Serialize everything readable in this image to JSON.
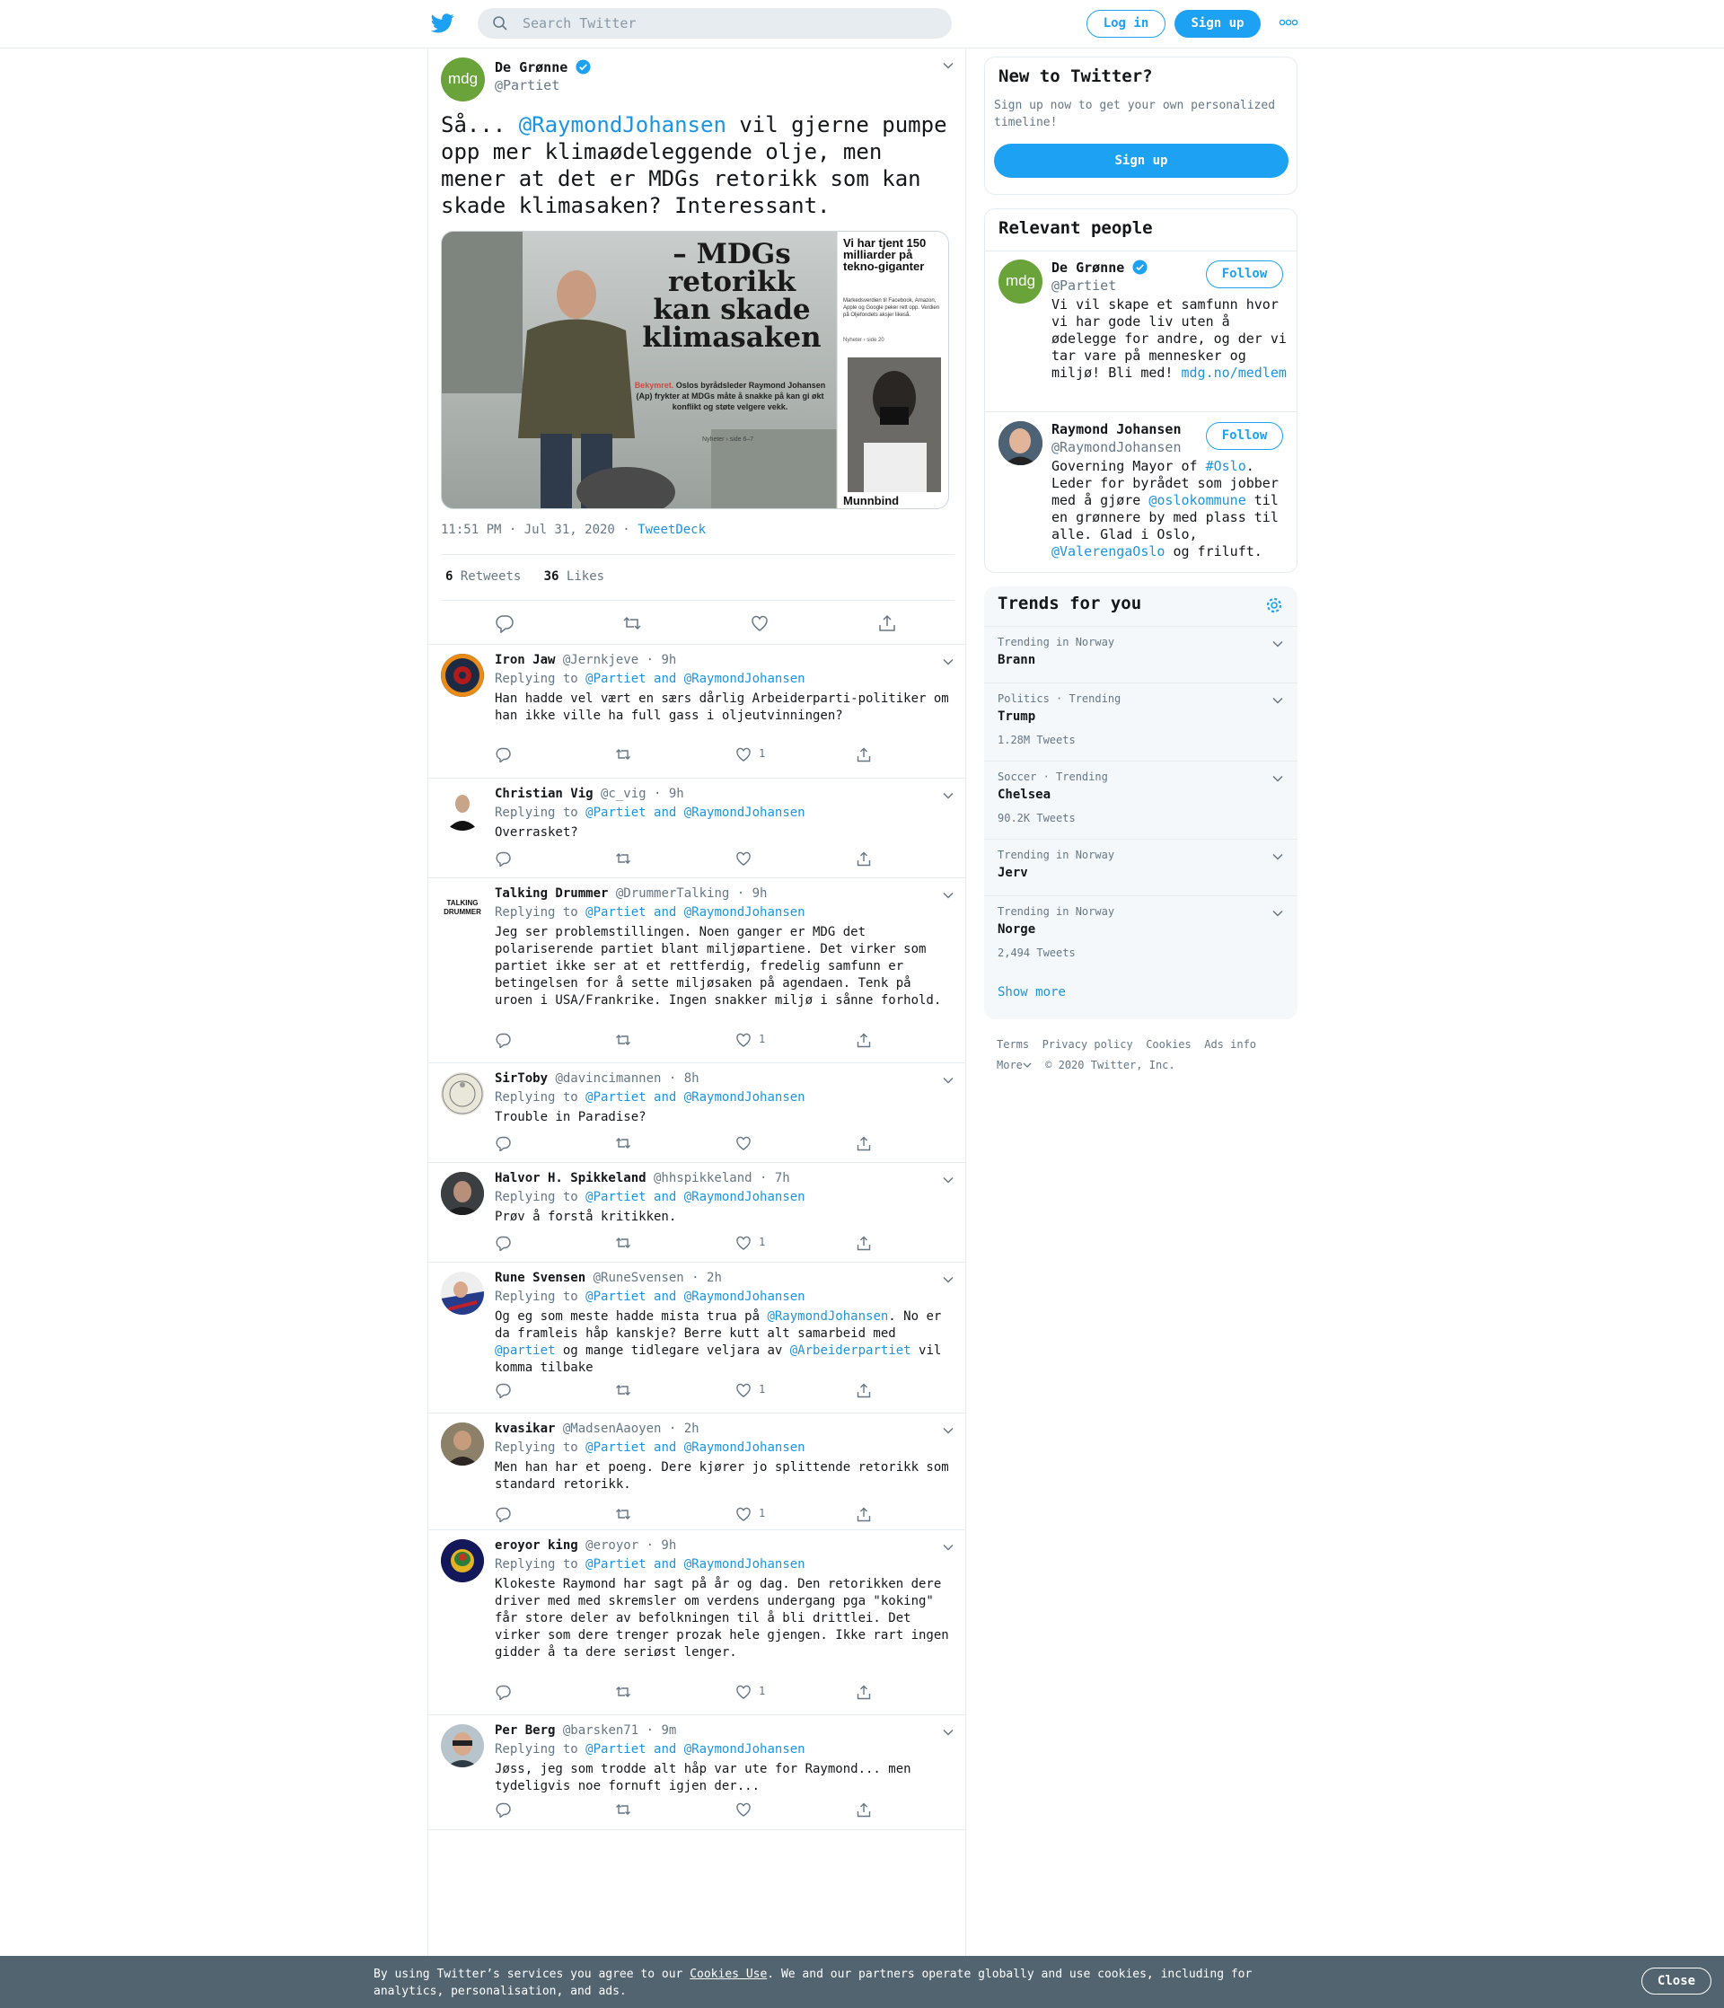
{
  "header": {
    "search_placeholder": "Search Twitter",
    "login": "Log in",
    "signup": "Sign up"
  },
  "main_tweet": {
    "name": "De Grønne",
    "handle": "@Partiet",
    "avatar_text": "mdg",
    "text_pre": "Så... ",
    "mention": "@RaymondJohansen",
    "text_post": " vil gjerne pumpe opp mer klimaødeleggende olje, men mener at det er MDGs retorikk som kan skade klimasaken? Interessant.",
    "image": {
      "headline": "– MDGs retorikk kan skade klimasaken",
      "lead_red": "Bekymret.",
      "lead": "Oslos byrådsleder Raymond Johansen (Ap) frykter at MDGs måte å snakke på kan gi økt konflikt og støte velgere vekk.",
      "ref": "Nyheter › side 6–7",
      "side_headline": "Vi har tjent 150 milliarder på tekno-giganter",
      "side_body": "Markedsverdien til Facebook, Amazon, Apple og Google peker rett opp. Verdien på Oljefondets aksjer likeså.",
      "side_ref": "Nyheter › side 20",
      "side_bottom": "Munnbind"
    },
    "time": "11:51 PM · Jul 31, 2020",
    "via": "TweetDeck",
    "retweets_count": "6",
    "retweets_label": "Retweets",
    "likes_count": "36",
    "likes_label": "Likes"
  },
  "replying_label": "Replying to",
  "replying_and": "and",
  "replying_to": [
    "@Partiet",
    "@RaymondJohansen"
  ],
  "replies": [
    {
      "name": "Iron Jaw",
      "handle": "@Jernkjeve",
      "time": "9h",
      "text": "Han hadde vel vært en særs dårlig Arbeiderparti-politiker om han ikke ville ha full gass i oljeutvinningen?",
      "likes": "1"
    },
    {
      "name": "Christian Vig",
      "handle": "@c_vig",
      "time": "9h",
      "text": "Overrasket?",
      "likes": ""
    },
    {
      "name": "Talking Drummer",
      "handle": "@DrummerTalking",
      "time": "9h",
      "text": "Jeg ser problemstillingen. Noen ganger er MDG det polariserende partiet blant miljøpartiene. Det virker som partiet ikke ser at et rettferdig, fredelig samfunn er betingelsen for å sette miljøsaken på agendaen. Tenk på uroen i USA/Frankrike. Ingen snakker miljø i sånne forhold.",
      "likes": "1",
      "avatar_text": "TALKING DRUMMER"
    },
    {
      "name": "SirToby",
      "handle": "@davincimannen",
      "time": "8h",
      "text": "Trouble in Paradise?",
      "likes": ""
    },
    {
      "name": "Halvor H. Spikkeland",
      "handle": "@hhspikkeland",
      "time": "7h",
      "text": "Prøv å forstå kritikken.",
      "likes": "1"
    },
    {
      "name": "Rune Svensen",
      "handle": "@RuneSvensen",
      "time": "2h",
      "text_parts": [
        "Og eg som meste hadde mista trua på ",
        "@RaymondJohansen",
        ". No er da framleis håp kanskje? Berre kutt alt samarbeid med ",
        "@partiet",
        " og mange tidlegare veljara av ",
        "@Arbeiderpartiet",
        " vil komma tilbake"
      ],
      "likes": "1"
    },
    {
      "name": "kvasikar",
      "handle": "@MadsenAaoyen",
      "time": "2h",
      "text": "Men han har et poeng. Dere kjører jo splittende retorikk som standard retorikk.",
      "likes": "1"
    },
    {
      "name": "eroyor king",
      "handle": "@eroyor",
      "time": "9h",
      "text": "Klokeste Raymond har sagt på år og dag. Den retorikken dere driver med med skremsler om verdens undergang pga \"koking\" får store deler av befolkningen til å bli drittlei. Det virker som dere trenger prozak hele gjengen. Ikke rart ingen gidder å ta dere seriøst lenger.",
      "likes": "1"
    },
    {
      "name": "Per Berg",
      "handle": "@barsken71",
      "time": "9m",
      "text": "Jøss, jeg som trodde alt håp var ute for Raymond... men tydeligvis noe fornuft igjen der...",
      "likes": ""
    }
  ],
  "sidebar": {
    "new_title": "New to Twitter?",
    "new_text": "Sign up now to get your own personalized timeline!",
    "new_button": "Sign up",
    "relevant_title": "Relevant people",
    "follow_label": "Follow",
    "people": [
      {
        "name": "De Grønne",
        "handle": "@Partiet",
        "bio": "Vi vil skape et samfunn hvor vi har gode liv uten å ødelegge for andre, og der vi tar vare på mennesker og miljø! Bli med!",
        "link": "mdg.no/medlem"
      },
      {
        "name": "Raymond Johansen",
        "handle": "@RaymondJohansen",
        "bio_parts": [
          "Governing Mayor of ",
          "#Oslo",
          ". Leder for byrådet som jobber med å gjøre ",
          "@oslokommune",
          " til en grønnere by med plass til alle. Glad i Oslo, ",
          "@ValerengaOslo",
          " og friluft."
        ]
      }
    ],
    "trends_title": "Trends for you",
    "trends": [
      {
        "context": "Trending in Norway",
        "name": "Brann",
        "count": ""
      },
      {
        "context": "Politics · Trending",
        "name": "Trump",
        "count": "1.28M Tweets"
      },
      {
        "context": "Soccer · Trending",
        "name": "Chelsea",
        "count": "90.2K Tweets"
      },
      {
        "context": "Trending in Norway",
        "name": "Jerv",
        "count": ""
      },
      {
        "context": "Trending in Norway",
        "name": "Norge",
        "count": "2,494 Tweets"
      }
    ],
    "show_more": "Show more",
    "footer_links": [
      "Terms",
      "Privacy policy",
      "Cookies",
      "Ads info"
    ],
    "footer_more": "More",
    "copyright": "© 2020 Twitter, Inc."
  },
  "cookie": {
    "pre": "By using Twitter’s services you agree to our ",
    "link": "Cookies Use",
    "post": ". We and our partners operate globally and use cookies, including for analytics, personalisation, and ads.",
    "close": "Close"
  },
  "colors": {
    "accent": "#1da1f2",
    "link": "#1b95e0",
    "mdg_green": "#6aa33a",
    "cookie_bg": "#536471"
  }
}
